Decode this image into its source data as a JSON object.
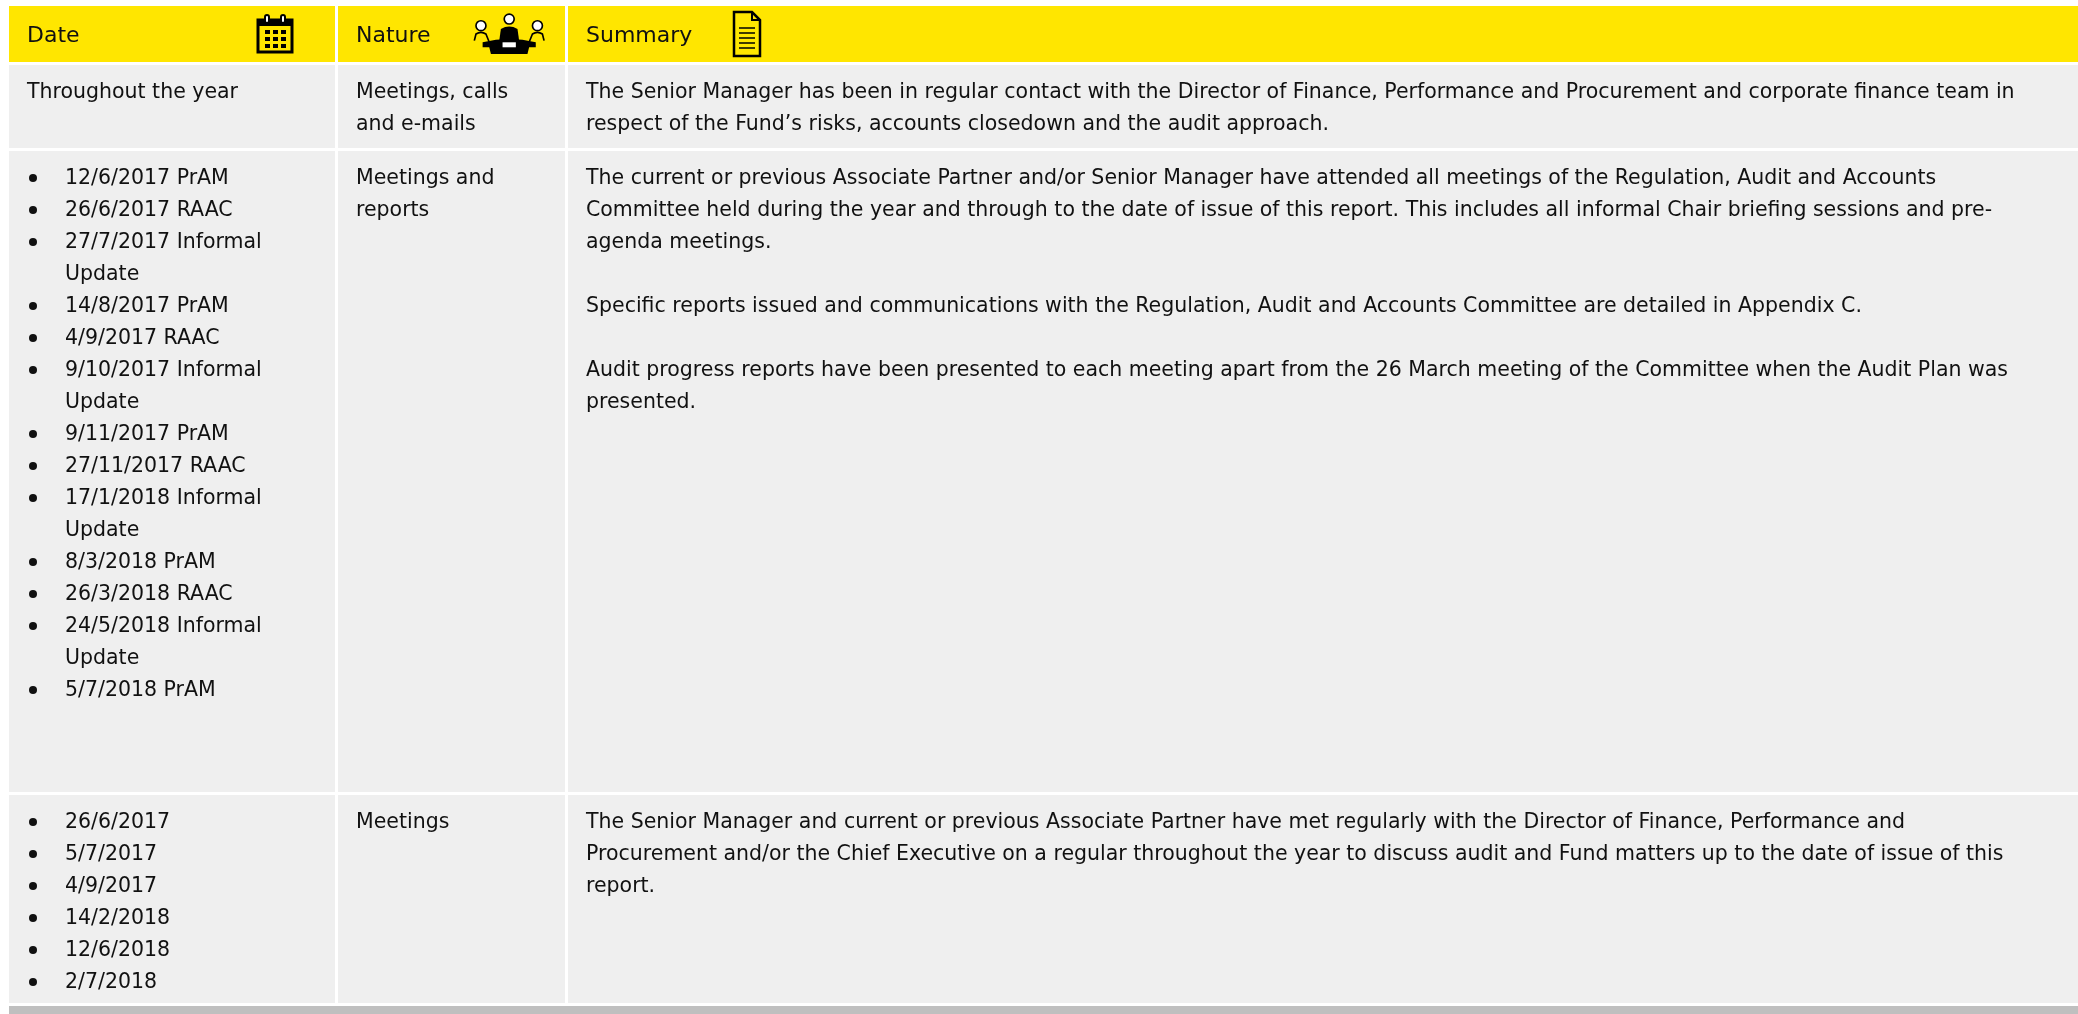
{
  "columns": [
    {
      "label": "Date"
    },
    {
      "label": "Nature"
    },
    {
      "label": "Summary"
    }
  ],
  "rows": [
    {
      "date": {
        "kind": "text",
        "text": "Throughout the year"
      },
      "nature": "Meetings, calls and e-mails",
      "summary": [
        "The Senior Manager has been in regular contact with the Director of Finance, Performance and Procurement and corporate finance team in respect of the Fund’s risks, accounts closedown and the audit approach."
      ]
    },
    {
      "date": {
        "kind": "list",
        "items": [
          "12/6/2017 PrAM",
          "26/6/2017 RAAC",
          "27/7/2017 Informal Update",
          "14/8/2017 PrAM",
          "4/9/2017 RAAC",
          "9/10/2017 Informal Update",
          "9/11/2017 PrAM",
          "27/11/2017 RAAC",
          "17/1/2018 Informal Update",
          "8/3/2018 PrAM",
          "26/3/2018 RAAC",
          "24/5/2018 Informal Update",
          "5/7/2018 PrAM"
        ]
      },
      "nature": "Meetings and reports",
      "summary": [
        "The current or previous Associate Partner and/or Senior Manager have attended all meetings of the Regulation, Audit and Accounts Committee held during the year and through to the date of issue of this report. This includes all informal Chair briefing sessions and pre-agenda meetings.",
        "Specific reports issued and communications with the Regulation, Audit and Accounts Committee are detailed in Appendix C.",
        "Audit progress reports have been presented to each meeting apart from the 26 March meeting of the Committee when the Audit Plan was presented."
      ]
    },
    {
      "date": {
        "kind": "list",
        "items": [
          "26/6/2017",
          "5/7/2017",
          "4/9/2017",
          "14/2/2018",
          "12/6/2018",
          "2/7/2018"
        ]
      },
      "nature": "Meetings",
      "summary": [
        "The Senior Manager and current or previous Associate Partner have met regularly with the Director of Finance, Performance and Procurement and/or the Chief Executive on a regular throughout the year to discuss audit and Fund matters up to the date of issue of this report."
      ]
    }
  ]
}
